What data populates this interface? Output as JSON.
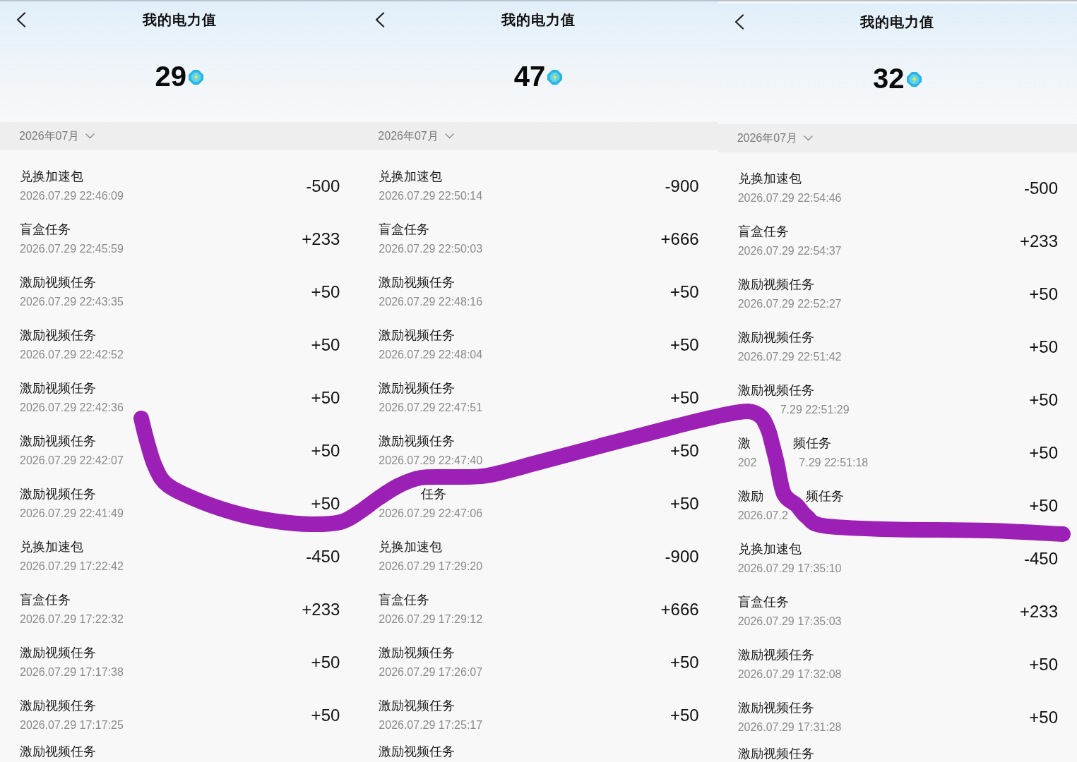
{
  "screens": [
    {
      "title": "我的电力值",
      "balance": "29",
      "month": "2026年07月",
      "records": [
        {
          "title": "兑换加速包",
          "time": "2026.07.29 22:46:09",
          "amount": "-500"
        },
        {
          "title": "盲盒任务",
          "time": "2026.07.29 22:45:59",
          "amount": "+233"
        },
        {
          "title": "激励视频任务",
          "time": "2026.07.29 22:43:35",
          "amount": "+50"
        },
        {
          "title": "激励视频任务",
          "time": "2026.07.29 22:42:52",
          "amount": "+50"
        },
        {
          "title": "激励视频任务",
          "time": "2026.07.29 22:42:36",
          "amount": "+50"
        },
        {
          "title": "激励视频任务",
          "time": "2026.07.29 22:42:07",
          "amount": "+50"
        },
        {
          "title": "激励视频任务",
          "time": "2026.07.29 22:41:49",
          "amount": "+50"
        },
        {
          "title": "兑换加速包",
          "time": "2026.07.29 17:22:42",
          "amount": "-450"
        },
        {
          "title": "盲盒任务",
          "time": "2026.07.29 17:22:32",
          "amount": "+233"
        },
        {
          "title": "激励视频任务",
          "time": "2026.07.29 17:17:38",
          "amount": "+50"
        },
        {
          "title": "激励视频任务",
          "time": "2026.07.29 17:17:25",
          "amount": "+50"
        },
        {
          "title": "激励视频任务"
        }
      ]
    },
    {
      "title": "我的电力值",
      "balance": "47",
      "month": "2026年07月",
      "records": [
        {
          "title": "兑换加速包",
          "time": "2026.07.29 22:50:14",
          "amount": "-900"
        },
        {
          "title": "盲盒任务",
          "time": "2026.07.29 22:50:03",
          "amount": "+666"
        },
        {
          "title": "激励视频任务",
          "time": "2026.07.29 22:48:16",
          "amount": "+50"
        },
        {
          "title": "激励视频任务",
          "time": "2026.07.29 22:48:04",
          "amount": "+50"
        },
        {
          "title": "激励视频任务",
          "time": "2026.07.29 22:47:51",
          "amount": "+50"
        },
        {
          "title": "激励视频任务",
          "time": "2026.07.29 22:47:40",
          "amount": "+50"
        },
        {
          "title": [
            {
              "text": "任务",
              "covered_before": true
            }
          ],
          "time": "2026.07.29 22:47:06",
          "amount": "+50"
        },
        {
          "title": "兑换加速包",
          "time": "2026.07.29 17:29:20",
          "amount": "-900"
        },
        {
          "title": "盲盒任务",
          "time": "2026.07.29 17:29:12",
          "amount": "+666"
        },
        {
          "title": "激励视频任务",
          "time": "2026.07.29 17:26:07",
          "amount": "+50"
        },
        {
          "title": "激励视频任务",
          "time": "2026.07.29 17:25:17",
          "amount": "+50"
        },
        {
          "title": "激励视频任务"
        }
      ]
    },
    {
      "title": "我的电力值",
      "balance": "32",
      "month": "2026年07月",
      "records": [
        {
          "title": "兑换加速包",
          "time": "2026.07.29 22:54:46",
          "amount": "-500"
        },
        {
          "title": "盲盒任务",
          "time": "2026.07.29 22:54:37",
          "amount": "+233"
        },
        {
          "title": "激励视频任务",
          "time": "2026.07.29 22:52:27",
          "amount": "+50"
        },
        {
          "title": "激励视频任务",
          "time": "2026.07.29 22:51:42",
          "amount": "+50"
        },
        {
          "title": "激励视频任务",
          "time": [
            {
              "text": "7.29 22:51:29",
              "covered_before": true
            }
          ],
          "amount": "+50"
        },
        {
          "title": [
            {
              "text": "激",
              "covered_before": false
            },
            {
              "text": "频任务",
              "covered_before": true
            }
          ],
          "time": [
            {
              "text": "202",
              "covered_before": false
            },
            {
              "text": "7.29 22:51:18",
              "covered_before": true
            }
          ],
          "amount": "+50"
        },
        {
          "title": [
            {
              "text": "激励",
              "covered_before": false
            },
            {
              "text": "频任务",
              "covered_before": true
            }
          ],
          "time": "2026.07.2",
          "amount": "+50"
        },
        {
          "title": "兑换加速包",
          "time": "2026.07.29 17:35:10",
          "amount": "-450"
        },
        {
          "title": "盲盒任务",
          "time": "2026.07.29 17:35:03",
          "amount": "+233"
        },
        {
          "title": "激励视频任务",
          "time": "2026.07.29 17:32:08",
          "amount": "+50"
        },
        {
          "title": "激励视频任务",
          "time": "2026.07.29 17:31:28",
          "amount": "+50"
        },
        {
          "title": "激励视频任务"
        }
      ]
    }
  ]
}
